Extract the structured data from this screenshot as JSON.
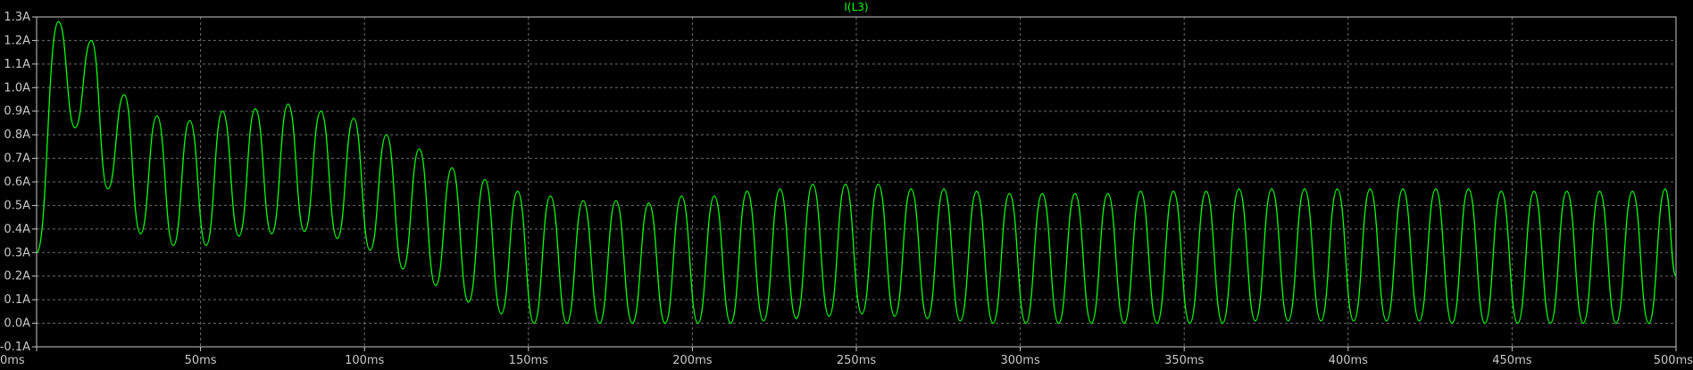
{
  "chart_data": {
    "type": "line",
    "title": "I(L3)",
    "xlabel": "",
    "ylabel": "",
    "xlim": [
      0,
      500
    ],
    "ylim": [
      -0.1,
      1.3
    ],
    "grid": true,
    "x_ticks": [
      0,
      50,
      100,
      150,
      200,
      250,
      300,
      350,
      400,
      450,
      500
    ],
    "x_tick_labels": [
      "0ms",
      "50ms",
      "100ms",
      "150ms",
      "200ms",
      "250ms",
      "300ms",
      "350ms",
      "400ms",
      "450ms",
      "500ms"
    ],
    "y_ticks": [
      -0.1,
      0.0,
      0.1,
      0.2,
      0.3,
      0.4,
      0.5,
      0.6,
      0.7,
      0.8,
      0.9,
      1.0,
      1.1,
      1.2,
      1.3
    ],
    "y_tick_labels": [
      "-0.1A",
      "0.0A",
      "0.1A",
      "0.2A",
      "0.3A",
      "0.4A",
      "0.5A",
      "0.6A",
      "0.7A",
      "0.8A",
      "0.9A",
      "1.0A",
      "1.1A",
      "1.2A",
      "1.3A"
    ],
    "colors": {
      "background": "#000000",
      "trace": "#00ff00",
      "grid": "#6e6e6e",
      "frame": "#c8c8c8",
      "text": "#c8c8c8"
    },
    "series": [
      {
        "name": "I(L3)",
        "color": "#00ff00",
        "x": [
          0,
          6.7,
          11.7,
          16.7,
          21.7,
          26.7,
          31.7,
          36.7,
          41.7,
          46.7,
          51.7,
          56.7,
          61.7,
          66.7,
          71.7,
          76.7,
          81.7,
          86.7,
          91.7,
          96.7,
          101.7,
          106.7,
          111.7,
          116.7,
          121.7,
          126.7,
          131.7,
          136.7,
          141.7,
          146.7,
          151.7,
          156.7,
          161.7,
          166.7,
          171.7,
          176.7,
          181.7,
          186.7,
          191.7,
          196.7,
          201.7,
          206.7,
          211.7,
          216.7,
          221.7,
          226.7,
          231.7,
          236.7,
          241.7,
          246.7,
          251.7,
          256.7,
          261.7,
          266.7,
          271.7,
          276.7,
          281.7,
          286.7,
          291.7,
          296.7,
          301.7,
          306.7,
          311.7,
          316.7,
          321.7,
          326.7,
          331.7,
          336.7,
          341.7,
          346.7,
          351.7,
          356.7,
          361.7,
          366.7,
          371.7,
          376.7,
          381.7,
          386.7,
          391.7,
          396.7,
          401.7,
          406.7,
          411.7,
          416.7,
          421.7,
          426.7,
          431.7,
          436.7,
          441.7,
          446.7,
          451.7,
          456.7,
          461.7,
          466.7,
          471.7,
          476.7,
          481.7,
          486.7,
          491.7,
          496.7,
          500
        ],
        "y": [
          0.3,
          1.28,
          0.83,
          1.2,
          0.57,
          0.97,
          0.38,
          0.88,
          0.33,
          0.86,
          0.33,
          0.9,
          0.37,
          0.91,
          0.38,
          0.93,
          0.39,
          0.9,
          0.36,
          0.87,
          0.31,
          0.8,
          0.23,
          0.74,
          0.16,
          0.66,
          0.09,
          0.61,
          0.04,
          0.56,
          0.0,
          0.54,
          0.0,
          0.52,
          0.0,
          0.52,
          0.0,
          0.51,
          0.0,
          0.54,
          0.0,
          0.54,
          0.0,
          0.56,
          0.01,
          0.57,
          0.02,
          0.59,
          0.03,
          0.59,
          0.04,
          0.59,
          0.03,
          0.57,
          0.02,
          0.57,
          0.01,
          0.56,
          0.0,
          0.55,
          0.0,
          0.55,
          0.0,
          0.55,
          0.0,
          0.55,
          0.0,
          0.56,
          0.0,
          0.56,
          0.0,
          0.56,
          0.0,
          0.57,
          0.01,
          0.57,
          0.01,
          0.57,
          0.01,
          0.57,
          0.01,
          0.57,
          0.01,
          0.57,
          0.01,
          0.57,
          0.0,
          0.57,
          0.0,
          0.56,
          0.0,
          0.56,
          0.0,
          0.56,
          0.0,
          0.56,
          0.0,
          0.56,
          0.0,
          0.57,
          0.2
        ]
      }
    ]
  }
}
